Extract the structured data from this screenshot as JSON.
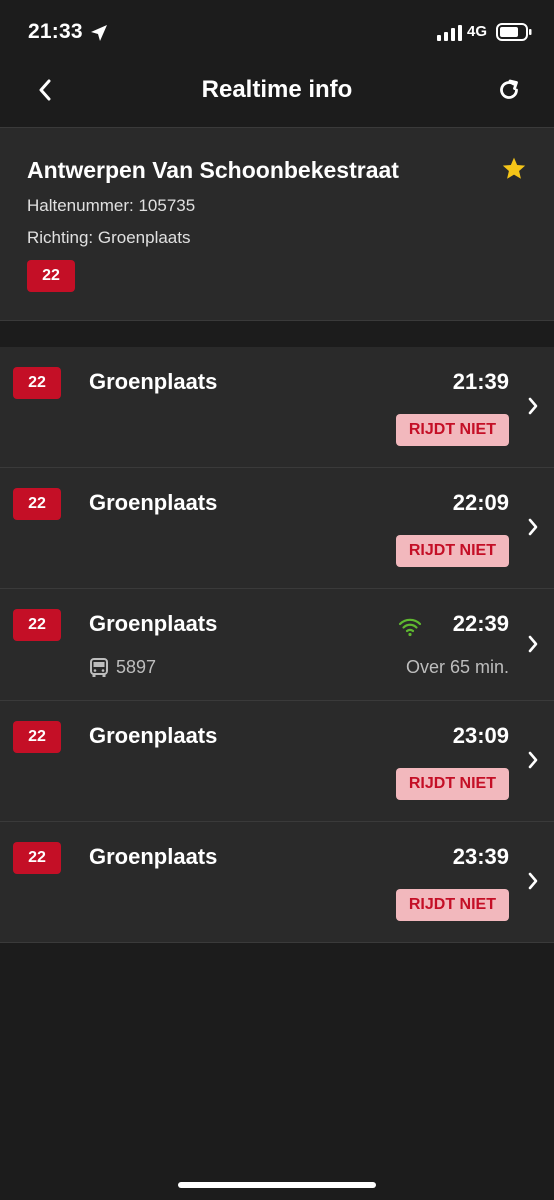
{
  "status_bar": {
    "time": "21:33",
    "network": "4G"
  },
  "navbar": {
    "title": "Realtime info"
  },
  "stop": {
    "name": "Antwerpen Van Schoonbekestraat",
    "stop_number": "Haltenummer: 105735",
    "direction": "Richting: Groenplaats",
    "line": "22",
    "favorite": true
  },
  "departures": [
    {
      "line": "22",
      "destination": "Groenplaats",
      "time": "21:39",
      "status": "RIJDT NIET"
    },
    {
      "line": "22",
      "destination": "Groenplaats",
      "time": "22:09",
      "status": "RIJDT NIET"
    },
    {
      "line": "22",
      "destination": "Groenplaats",
      "time": "22:39",
      "realtime": true,
      "vehicle": "5897",
      "eta": "Over 65 min."
    },
    {
      "line": "22",
      "destination": "Groenplaats",
      "time": "23:09",
      "status": "RIJDT NIET"
    },
    {
      "line": "22",
      "destination": "Groenplaats",
      "time": "23:39",
      "status": "RIJDT NIET"
    }
  ],
  "colors": {
    "accent": "#c40f26",
    "status_bg": "#f2b8bd",
    "star": "#f5c518",
    "realtime": "#5fb830"
  }
}
